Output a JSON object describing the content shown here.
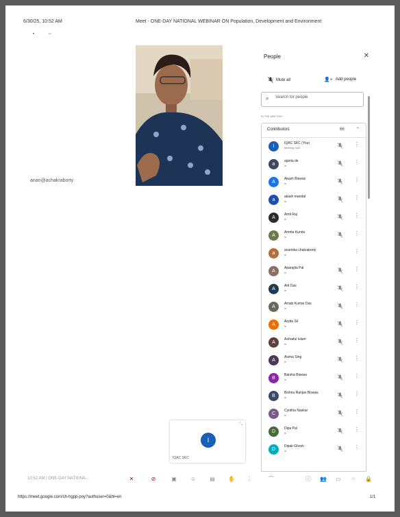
{
  "header": {
    "datetime": "6/30/25, 10:52 AM",
    "title": "Meet - ONE-DAY NATIONAL WEBINAR ON Population, Development and Environment"
  },
  "main": {
    "remote_name": "anan@achakraborty",
    "self_tile": {
      "initial": "I",
      "label": "IQAC SKC"
    }
  },
  "people": {
    "title": "People",
    "mute_all": "Mute all",
    "add_people": "Add people",
    "search_placeholder": "Search for people",
    "section_label": "IN THE MEETING",
    "contributors_label": "Contributors",
    "contributors_count": "66",
    "items": [
      {
        "name": "IQAC SKC (You)",
        "sub": "Meeting host",
        "initial": "I",
        "color": "#1b5fb5",
        "muted": true
      },
      {
        "name": "ajanta de",
        "sub": "le",
        "initial": "a",
        "color": "#3c4a5c",
        "muted": true
      },
      {
        "name": "Akash Biswas",
        "sub": "le",
        "initial": "A",
        "color": "#1a73e8",
        "muted": true
      },
      {
        "name": "akash mandal",
        "sub": "le",
        "initial": "a",
        "color": "#1a4fb0",
        "muted": true
      },
      {
        "name": "Amit Raj",
        "sub": "le",
        "initial": "A",
        "color": "#2b2b2b",
        "muted": true
      },
      {
        "name": "Amrita Kundu",
        "sub": "le",
        "initial": "A",
        "color": "#6b7a4a",
        "muted": true
      },
      {
        "name": "anamika chakraborty",
        "sub": "le",
        "initial": "a",
        "color": "#b07040",
        "muted": false
      },
      {
        "name": "Aparajita Pal",
        "sub": "le",
        "initial": "A",
        "color": "#8d6e63",
        "muted": true
      },
      {
        "name": "Arit Das",
        "sub": "le",
        "initial": "A",
        "color": "#1f3b4d",
        "muted": true
      },
      {
        "name": "Arnab Kumar Das",
        "sub": "le",
        "initial": "A",
        "color": "#6a6a5a",
        "muted": true
      },
      {
        "name": "Arpita Sil",
        "sub": "le",
        "initial": "A",
        "color": "#ef6c00",
        "muted": true
      },
      {
        "name": "Ashraful Islam",
        "sub": "le",
        "initial": "A",
        "color": "#5d4037",
        "muted": true
      },
      {
        "name": "Asima Sing",
        "sub": "le",
        "initial": "A",
        "color": "#4a3a5a",
        "muted": true
      },
      {
        "name": "Barsha Biswas",
        "sub": "le",
        "initial": "B",
        "color": "#8e24aa",
        "muted": true
      },
      {
        "name": "Bishnu Ranjan Biswas",
        "sub": "le",
        "initial": "B",
        "color": "#3a4a6a",
        "muted": true
      },
      {
        "name": "Cynthia Naskar",
        "sub": "le",
        "initial": "C",
        "color": "#7a5a8a",
        "muted": true
      },
      {
        "name": "Dipa Pal",
        "sub": "le",
        "initial": "D",
        "color": "#4a6a3a",
        "muted": true
      },
      {
        "name": "Dipak Ghosh",
        "sub": "le",
        "initial": "D",
        "color": "#00acc1",
        "muted": true
      }
    ]
  },
  "bottom_bar": {
    "text": "10:52 AM  |  ONE-DAY NATIONA..."
  },
  "footer": {
    "url": "https://meet.google.com/ch-hgpp-poy?authuser=0&hl=en",
    "page": "1/1"
  }
}
